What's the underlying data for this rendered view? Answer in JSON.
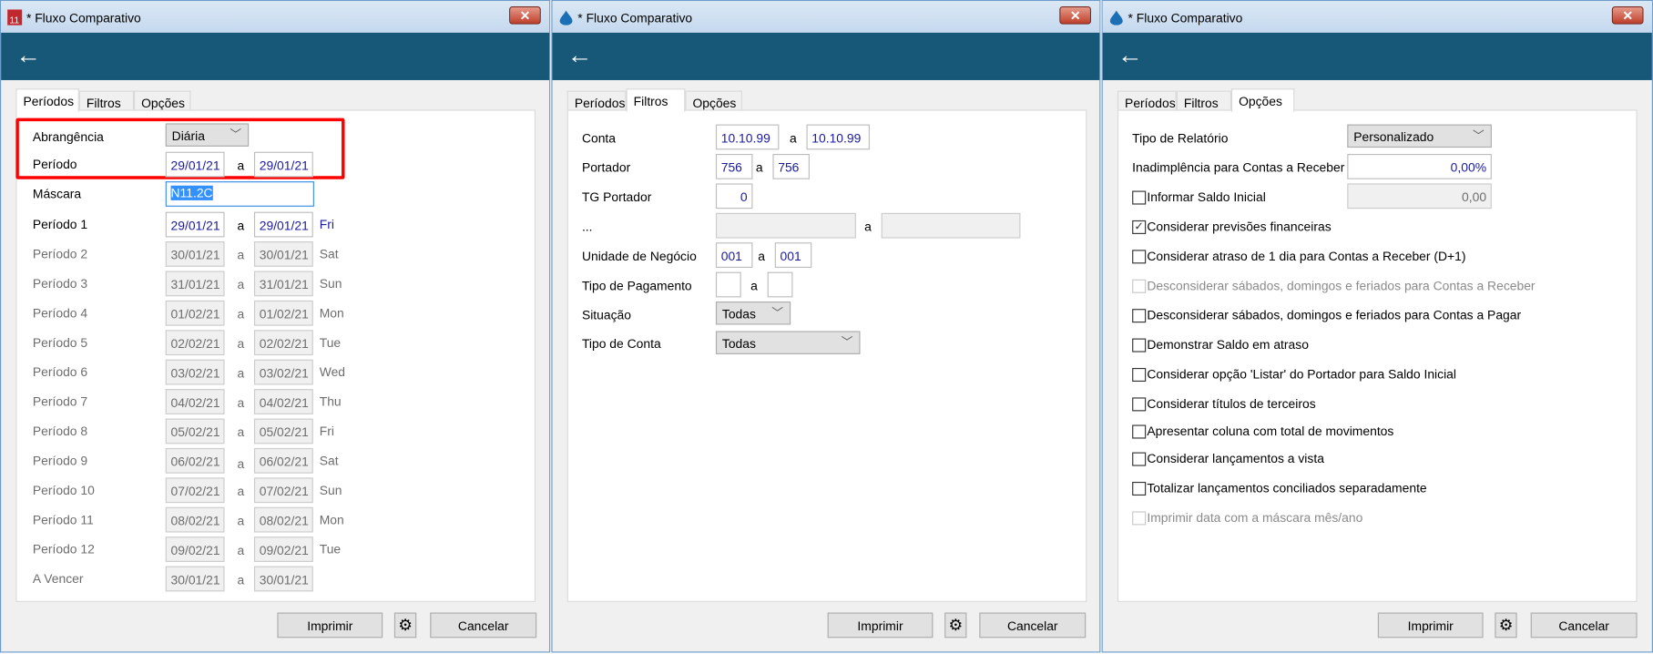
{
  "window_title": "* Fluxo Comparativo",
  "tabs": [
    "Períodos",
    "Filtros",
    "Opções"
  ],
  "buttons": {
    "print": "Imprimir",
    "cancel": "Cancelar"
  },
  "colors": {
    "header": "#175878",
    "highlight": "#ff0000",
    "value_text": "#1a1aa0"
  },
  "periodos": {
    "abrangencia": {
      "label": "Abrangência",
      "value": "Diária"
    },
    "periodo": {
      "label": "Período",
      "from": "29/01/21",
      "sep": "a",
      "to": "29/01/21"
    },
    "mascara": {
      "label": "Máscara",
      "value": "N11.2C"
    },
    "rows": [
      {
        "label": "Período 1",
        "from": "29/01/21",
        "to": "29/01/21",
        "day": "Fri",
        "enabled": true
      },
      {
        "label": "Período 2",
        "from": "30/01/21",
        "to": "30/01/21",
        "day": "Sat",
        "enabled": false
      },
      {
        "label": "Período 3",
        "from": "31/01/21",
        "to": "31/01/21",
        "day": "Sun",
        "enabled": false
      },
      {
        "label": "Período 4",
        "from": "01/02/21",
        "to": "01/02/21",
        "day": "Mon",
        "enabled": false
      },
      {
        "label": "Período 5",
        "from": "02/02/21",
        "to": "02/02/21",
        "day": "Tue",
        "enabled": false
      },
      {
        "label": "Período 6",
        "from": "03/02/21",
        "to": "03/02/21",
        "day": "Wed",
        "enabled": false
      },
      {
        "label": "Período 7",
        "from": "04/02/21",
        "to": "04/02/21",
        "day": "Thu",
        "enabled": false
      },
      {
        "label": "Período 8",
        "from": "05/02/21",
        "to": "05/02/21",
        "day": "Fri",
        "enabled": false
      },
      {
        "label": "Período 9",
        "from": "06/02/21",
        "to": "06/02/21",
        "day": "Sat",
        "enabled": false
      },
      {
        "label": "Período 10",
        "from": "07/02/21",
        "to": "07/02/21",
        "day": "Sun",
        "enabled": false
      },
      {
        "label": "Período 11",
        "from": "08/02/21",
        "to": "08/02/21",
        "day": "Mon",
        "enabled": false
      },
      {
        "label": "Período 12",
        "from": "09/02/21",
        "to": "09/02/21",
        "day": "Tue",
        "enabled": false
      },
      {
        "label": "A Vencer",
        "from": "30/01/21",
        "to": "30/01/21",
        "day": "",
        "enabled": false
      }
    ]
  },
  "filtros": {
    "sep": "a",
    "conta": {
      "label": "Conta",
      "from": "10.10.99",
      "to": "10.10.99"
    },
    "portador": {
      "label": "Portador",
      "from": "756",
      "to": "756"
    },
    "tg_portador": {
      "label": "TG Portador",
      "value": "0"
    },
    "ellipsis": {
      "label": "...",
      "from": "",
      "to": ""
    },
    "unidade": {
      "label": "Unidade de Negócio",
      "from": "001",
      "to": "001"
    },
    "tipo_pagamento": {
      "label": "Tipo de Pagamento",
      "from": "",
      "to": ""
    },
    "situacao": {
      "label": "Situação",
      "value": "Todas"
    },
    "tipo_conta": {
      "label": "Tipo de Conta",
      "value": "Todas"
    }
  },
  "opcoes": {
    "tipo_relatorio": {
      "label": "Tipo de Relatório",
      "value": "Personalizado"
    },
    "inadimplencia": {
      "label": "Inadimplência para Contas a Receber",
      "value": "0,00%"
    },
    "saldo_inicial": {
      "label": "Informar Saldo Inicial",
      "checked": false,
      "value": "0,00"
    },
    "checks": [
      {
        "label": "Considerar previsões financeiras",
        "checked": true,
        "enabled": true
      },
      {
        "label": "Considerar atraso de 1 dia para Contas a Receber (D+1)",
        "checked": false,
        "enabled": true
      },
      {
        "label": "Desconsiderar sábados, domingos e feriados para Contas a Receber",
        "checked": false,
        "enabled": false
      },
      {
        "label": "Desconsiderar sábados, domingos e feriados para Contas a Pagar",
        "checked": false,
        "enabled": true
      },
      {
        "label": "Demonstrar Saldo em atraso",
        "checked": false,
        "enabled": true
      },
      {
        "label": "Considerar opção 'Listar' do Portador para Saldo Inicial",
        "checked": false,
        "enabled": true
      },
      {
        "label": "Considerar títulos de terceiros",
        "checked": false,
        "enabled": true
      },
      {
        "label": "Apresentar coluna com total de movimentos",
        "checked": false,
        "enabled": true
      },
      {
        "label": "Considerar lançamentos a vista",
        "checked": false,
        "enabled": true
      },
      {
        "label": "Totalizar lançamentos conciliados separadamente",
        "checked": false,
        "enabled": true
      },
      {
        "label": "Imprimir data com a máscara mês/ano",
        "checked": false,
        "enabled": false
      }
    ]
  }
}
